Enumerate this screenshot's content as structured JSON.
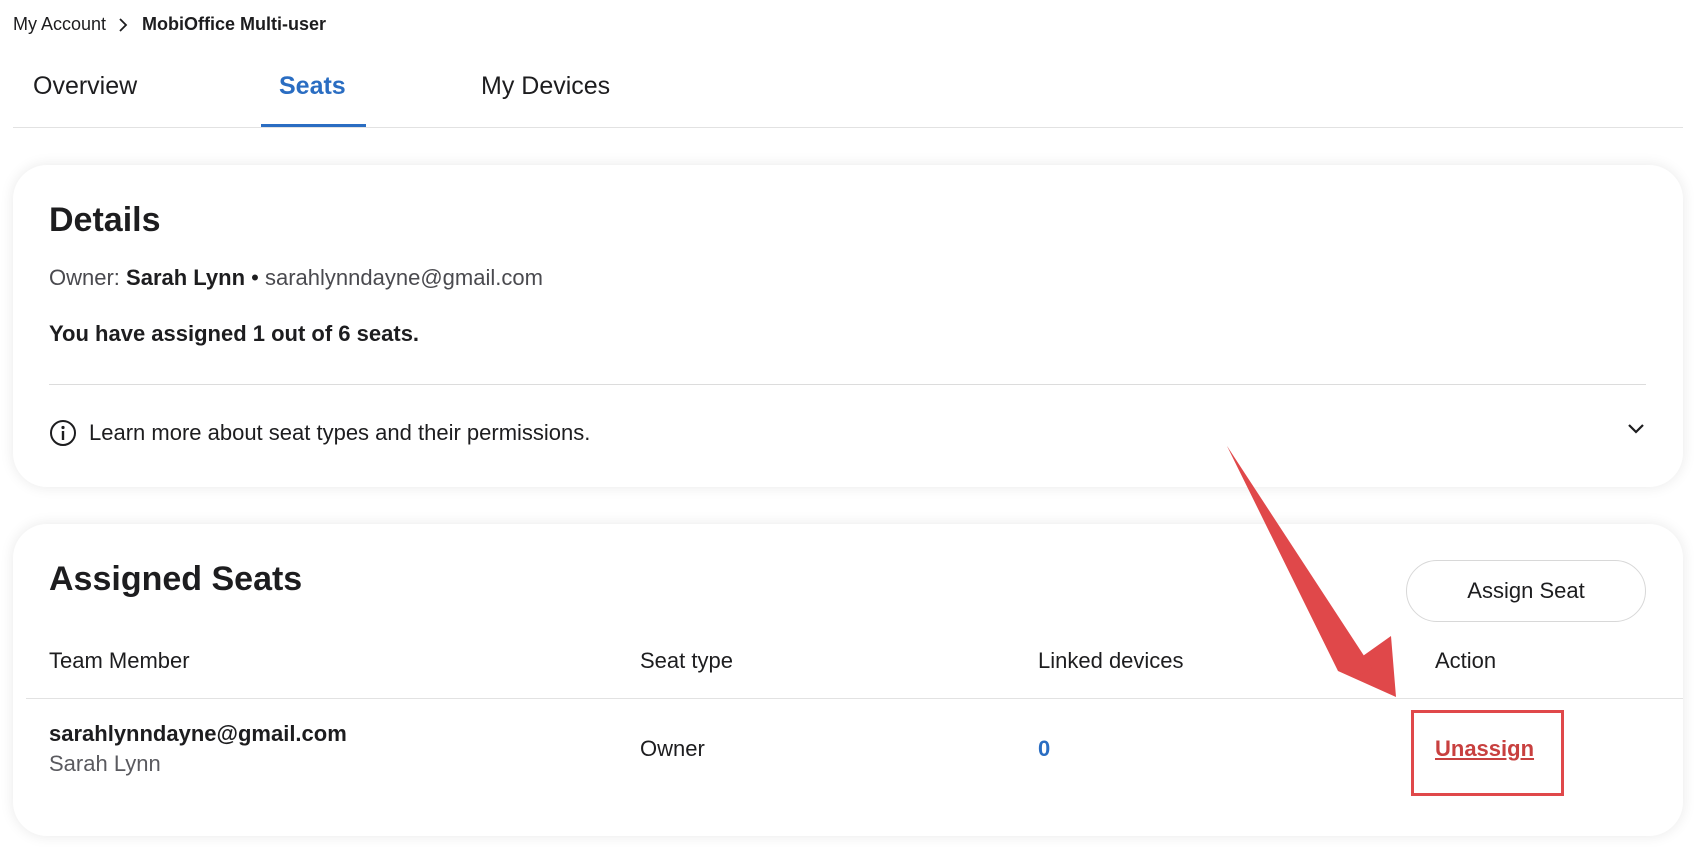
{
  "breadcrumb": {
    "parent": "My Account",
    "current": "MobiOffice Multi-user"
  },
  "tabs": [
    {
      "label": "Overview",
      "active": false
    },
    {
      "label": "Seats",
      "active": true
    },
    {
      "label": "My Devices",
      "active": false
    }
  ],
  "details": {
    "title": "Details",
    "owner_label": "Owner:",
    "owner_name": "Sarah Lynn",
    "separator": "•",
    "owner_email": "sarahlynndayne@gmail.com",
    "assigned_text": "You have assigned 1 out of 6 seats.",
    "learn_more": "Learn more about seat types and their permissions."
  },
  "assigned_seats": {
    "title": "Assigned Seats",
    "assign_button": "Assign Seat",
    "columns": [
      "Team Member",
      "Seat type",
      "Linked devices",
      "Action"
    ],
    "rows": [
      {
        "email": "sarahlynndayne@gmail.com",
        "name": "Sarah Lynn",
        "seat_type": "Owner",
        "linked_devices": "0",
        "action": "Unassign"
      }
    ]
  },
  "colors": {
    "accent": "#2a6dc2",
    "unassign": "#c8403f",
    "annotation": "#e0484a"
  },
  "icons": [
    "chevron-right-icon",
    "info-icon",
    "chevron-down-icon",
    "annotation-arrow"
  ]
}
